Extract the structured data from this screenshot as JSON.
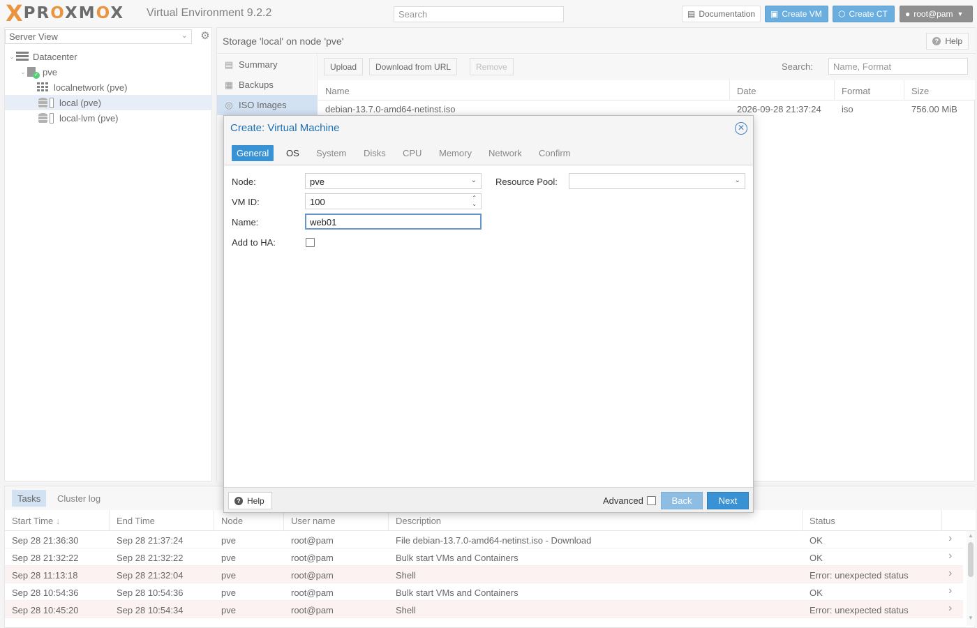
{
  "header": {
    "logo_text": "PROXMOX",
    "version": "Virtual Environment 9.2.2",
    "search_placeholder": "Search",
    "docs_label": "Documentation",
    "create_vm_label": "Create VM",
    "create_ct_label": "Create CT",
    "user_label": "root@pam"
  },
  "tree": {
    "view": "Server View",
    "items": [
      {
        "label": "Datacenter",
        "icon": "datacenter-icon"
      },
      {
        "label": "pve",
        "icon": "node-icon"
      },
      {
        "label": "localnetwork (pve)",
        "icon": "network-icon"
      },
      {
        "label": "local (pve)",
        "icon": "storage-icon",
        "selected": true
      },
      {
        "label": "local-lvm (pve)",
        "icon": "storage-icon"
      }
    ]
  },
  "main": {
    "breadcrumb": "Storage 'local' on node 'pve'",
    "help_label": "Help",
    "subnav": [
      {
        "label": "Summary",
        "icon": "book-icon"
      },
      {
        "label": "Backups",
        "icon": "floppy-icon"
      },
      {
        "label": "ISO Images",
        "icon": "disc-icon",
        "selected": true
      }
    ],
    "toolbar": {
      "upload": "Upload",
      "download_url": "Download from URL",
      "remove": "Remove",
      "search_label": "Search:",
      "search_placeholder": "Name, Format"
    },
    "grid": {
      "columns": [
        "Name",
        "Date",
        "Format",
        "Size"
      ],
      "rows": [
        [
          "debian-13.7.0-amd64-netinst.iso",
          "2026-09-28 21:37:24",
          "iso",
          "756.00 MiB"
        ]
      ]
    }
  },
  "dialog": {
    "title": "Create: Virtual Machine",
    "tabs": [
      "General",
      "OS",
      "System",
      "Disks",
      "CPU",
      "Memory",
      "Network",
      "Confirm"
    ],
    "active_tab": "General",
    "fields": {
      "node_label": "Node:",
      "node_value": "pve",
      "vmid_label": "VM ID:",
      "vmid_value": "100",
      "name_label": "Name:",
      "name_value": "web01",
      "ha_label": "Add to HA:",
      "ha_checked": false,
      "pool_label": "Resource Pool:",
      "pool_value": ""
    },
    "footer": {
      "help": "Help",
      "advanced": "Advanced",
      "advanced_checked": false,
      "back": "Back",
      "next": "Next"
    }
  },
  "tasks": {
    "tabs": [
      "Tasks",
      "Cluster log"
    ],
    "columns": [
      "Start Time",
      "End Time",
      "Node",
      "User name",
      "Description",
      "Status"
    ],
    "rows": [
      {
        "start": "Sep 28 21:36:30",
        "end": "Sep 28 21:37:24",
        "node": "pve",
        "user": "root@pam",
        "desc": "File debian-13.7.0-amd64-netinst.iso - Download",
        "status": "OK",
        "error": false
      },
      {
        "start": "Sep 28 21:32:22",
        "end": "Sep 28 21:32:22",
        "node": "pve",
        "user": "root@pam",
        "desc": "Bulk start VMs and Containers",
        "status": "OK",
        "error": false
      },
      {
        "start": "Sep 28 11:13:18",
        "end": "Sep 28 21:32:04",
        "node": "pve",
        "user": "root@pam",
        "desc": "Shell",
        "status": "Error: unexpected status",
        "error": true
      },
      {
        "start": "Sep 28 10:54:36",
        "end": "Sep 28 10:54:36",
        "node": "pve",
        "user": "root@pam",
        "desc": "Bulk start VMs and Containers",
        "status": "OK",
        "error": false
      },
      {
        "start": "Sep 28 10:45:20",
        "end": "Sep 28 10:54:34",
        "node": "pve",
        "user": "root@pam",
        "desc": "Shell",
        "status": "Error: unexpected status",
        "error": true
      }
    ]
  },
  "colors": {
    "accent": "#3892d4",
    "brand_orange": "#e57000",
    "error_row": "#fceeee"
  }
}
